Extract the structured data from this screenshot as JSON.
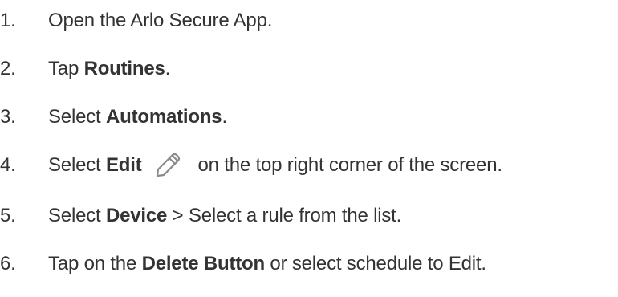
{
  "steps": [
    {
      "number": "1.",
      "pre": "Open the Arlo Secure App.",
      "bold": "",
      "post": ""
    },
    {
      "number": "2.",
      "pre": "Tap ",
      "bold": "Routines",
      "post": "."
    },
    {
      "number": "3.",
      "pre": "Select ",
      "bold": "Automations",
      "post": "."
    },
    {
      "number": "4.",
      "pre": "Select ",
      "bold": "Edit",
      "icon": "pencil-icon",
      "post": "on the top right corner of the screen."
    },
    {
      "number": "5.",
      "pre": "Select ",
      "bold": "Device",
      "post": " > Select a rule from the list."
    },
    {
      "number": "6.",
      "pre": "Tap on the ",
      "bold": "Delete Button",
      "post": " or select schedule to Edit."
    }
  ]
}
